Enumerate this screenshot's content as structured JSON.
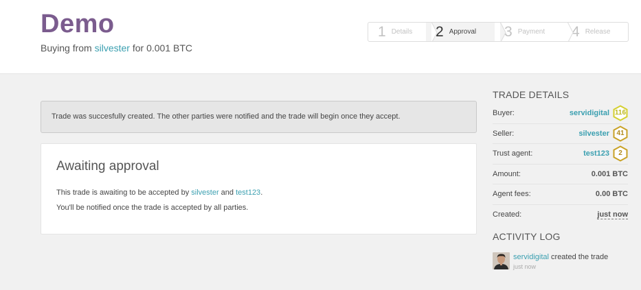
{
  "header": {
    "title": "Demo",
    "subtitle_prefix": "Buying from ",
    "seller_link": "silvester",
    "subtitle_suffix": " for 0.001 BTC"
  },
  "steps": [
    {
      "num": "1",
      "label": "Details",
      "active": false
    },
    {
      "num": "2",
      "label": "Approval",
      "active": true
    },
    {
      "num": "3",
      "label": "Payment",
      "active": false
    },
    {
      "num": "4",
      "label": "Release",
      "active": false
    }
  ],
  "notice": "Trade was succesfully created. The other parties were notified and the trade will begin once they accept.",
  "card": {
    "title": "Awaiting approval",
    "line1_prefix": "This trade is awaiting to be accepted by ",
    "party1": "silvester",
    "line1_and": " and ",
    "party2": "test123",
    "line1_suffix": ".",
    "line2": "You'll be notified once the trade is accepted by all parties."
  },
  "trade_details": {
    "title": "TRADE DETAILS",
    "buyer": {
      "label": "Buyer:",
      "name": "servidigital",
      "score": "116",
      "badge_color": "#d4cf2e"
    },
    "seller": {
      "label": "Seller:",
      "name": "silvester",
      "score": "41",
      "badge_color": "#c9a227"
    },
    "agent": {
      "label": "Trust agent:",
      "name": "test123",
      "score": "2",
      "badge_color": "#c9a227"
    },
    "amount": {
      "label": "Amount:",
      "value": "0.001 BTC"
    },
    "fees": {
      "label": "Agent fees:",
      "value": "0.00 BTC"
    },
    "created": {
      "label": "Created:",
      "value": "just now"
    }
  },
  "activity": {
    "title": "ACTIVITY LOG",
    "entries": [
      {
        "user": "servidigital",
        "action": " created the trade",
        "time": "just now"
      }
    ]
  },
  "colors": {
    "brand": "#7b5c8e",
    "link": "#3a9fb0"
  }
}
